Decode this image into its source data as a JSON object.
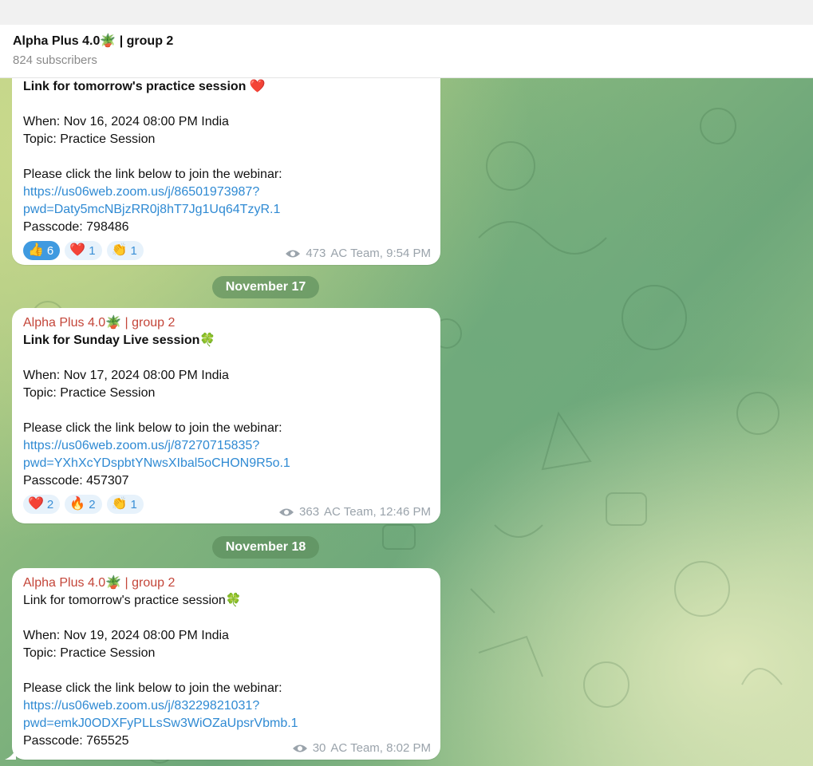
{
  "header": {
    "title": "Alpha Plus 4.0🪴 | group 2",
    "subscribers": "824 subscribers"
  },
  "messages": [
    {
      "heading": "Link for tomorrow's practice session ❤️",
      "when": "When: Nov 16, 2024 08:00 PM India",
      "topic": "Topic: Practice Session",
      "instruction": "Please click the link below to join the webinar:",
      "link_line1": "https://us06web.zoom.us/j/86501973987?",
      "link_line2": "pwd=Daty5mcNBjzRR0j8hT7Jg1Uq64TzyR.1",
      "passcode": "Passcode: 798486",
      "reactions": [
        {
          "emoji": "👍",
          "count": "6"
        },
        {
          "emoji": "❤️",
          "count": "1"
        },
        {
          "emoji": "👏",
          "count": "1"
        }
      ],
      "views": "473",
      "footer": "AC Team, 9:54 PM"
    },
    {
      "sender": "Alpha Plus 4.0🪴 | group 2",
      "heading": "Link for Sunday Live session🍀",
      "when": "When: Nov 17, 2024 08:00 PM India",
      "topic": "Topic: Practice Session",
      "instruction": "Please click the link below to join the webinar:",
      "link_line1": "https://us06web.zoom.us/j/87270715835?",
      "link_line2": "pwd=YXhXcYDspbtYNwsXIbal5oCHON9R5o.1",
      "passcode": "Passcode: 457307",
      "reactions": [
        {
          "emoji": "❤️",
          "count": "2"
        },
        {
          "emoji": "🔥",
          "count": "2"
        },
        {
          "emoji": "👏",
          "count": "1"
        }
      ],
      "views": "363",
      "footer": "AC Team, 12:46 PM"
    },
    {
      "sender": "Alpha Plus 4.0🪴 | group 2",
      "heading": "Link for tomorrow's practice session🍀",
      "when": "When: Nov 19, 2024 08:00 PM India",
      "topic": "Topic: Practice Session",
      "instruction": "Please click the link below to join the webinar:",
      "link_line1": "https://us06web.zoom.us/j/83229821031?",
      "link_line2": "pwd=emkJ0ODXFyPLLsSw3WiOZaUpsrVbmb.1",
      "passcode": "Passcode: 765525",
      "views": "30",
      "footer": "AC Team, 8:02 PM"
    }
  ],
  "date_separators": [
    "November 17",
    "November 18"
  ],
  "colors": {
    "sender": "#c4463a",
    "link": "#2f8ad3",
    "reaction_active": "#3f9ae0"
  }
}
